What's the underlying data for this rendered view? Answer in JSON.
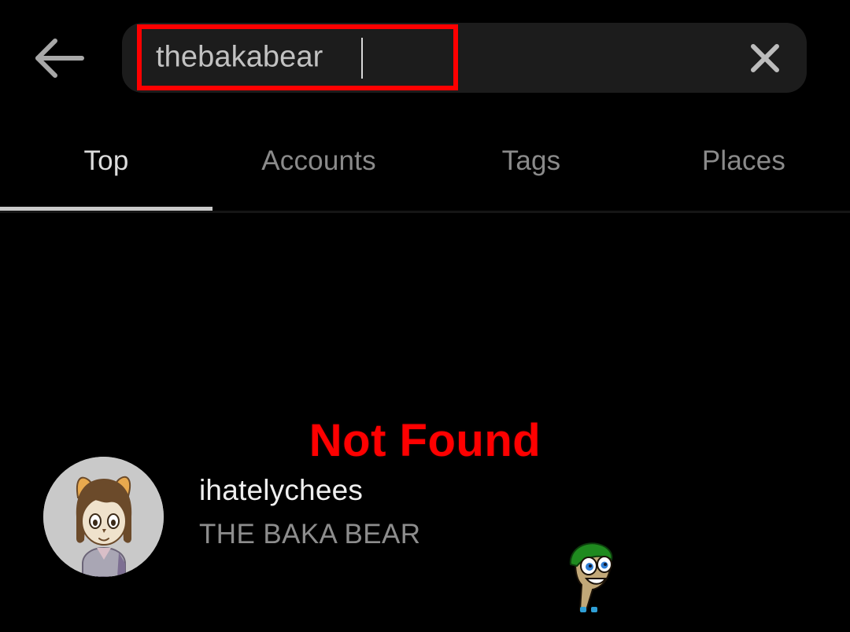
{
  "theme": {
    "background": "#000000",
    "searchbar_bg": "#1c1c1c",
    "text_primary": "#efefef",
    "text_secondary": "#8d8d8d",
    "tab_active": "#dcdcdc",
    "tab_inactive": "#8a8a8a",
    "annotation_red": "#fe0000",
    "avatar_bg": "#c9c9c9"
  },
  "header": {
    "back_icon": "back-arrow-icon",
    "clear_icon": "close-x-icon",
    "search": {
      "value": "thebakabear",
      "placeholder": "Search",
      "caret_visible": true
    }
  },
  "tabs": {
    "items": [
      {
        "label": "Top",
        "active": true
      },
      {
        "label": "Accounts",
        "active": false
      },
      {
        "label": "Tags",
        "active": false
      },
      {
        "label": "Places",
        "active": false
      }
    ]
  },
  "results": [
    {
      "username": "ihatelychees",
      "fullname": "THE BAKA BEAR",
      "avatar_icon": "user-avatar-cartoon-girl"
    }
  ],
  "annotations": {
    "search_highlight_label": "search-field-highlight",
    "not_found_text": "Not Found"
  },
  "overlay": {
    "floating_avatar_icon": "cartoon-face-green-cap-avatar"
  }
}
